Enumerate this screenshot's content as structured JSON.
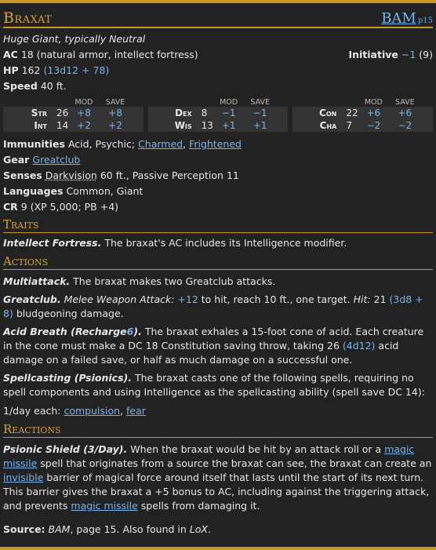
{
  "header": {
    "name": "Braxat",
    "source": "BAM",
    "page": "p15"
  },
  "meta": {
    "type_line": "Huge Giant, typically Neutral"
  },
  "ac": {
    "label": "AC",
    "value": "18 (natural armor, intellect fortress)"
  },
  "initiative": {
    "label": "Initiative",
    "mod": "−1",
    "score": "(9)"
  },
  "hp": {
    "label": "HP",
    "value": "162",
    "formula": "(13d12 + 78)"
  },
  "speed": {
    "label": "Speed",
    "value": "40 ft."
  },
  "stat_headers": {
    "mod": "MOD",
    "save": "SAVE"
  },
  "stats": [
    [
      {
        "ab": "Str",
        "score": "26",
        "mod": "+8",
        "save": "+8"
      },
      {
        "ab": "Int",
        "score": "14",
        "mod": "+2",
        "save": "+2"
      }
    ],
    [
      {
        "ab": "Dex",
        "score": "8",
        "mod": "−1",
        "save": "−1"
      },
      {
        "ab": "Wis",
        "score": "13",
        "mod": "+1",
        "save": "+1"
      }
    ],
    [
      {
        "ab": "Con",
        "score": "22",
        "mod": "+6",
        "save": "+6"
      },
      {
        "ab": "Cha",
        "score": "7",
        "mod": "−2",
        "save": "−2"
      }
    ]
  ],
  "immunities": {
    "label": "Immunities",
    "text": "Acid, Psychic;",
    "link1": "Charmed",
    "link2": "Frightened"
  },
  "gear": {
    "label": "Gear",
    "link": "Greatclub"
  },
  "senses": {
    "label": "Senses",
    "dv": "Darkvision",
    "text": "60 ft., Passive Perception 11"
  },
  "languages": {
    "label": "Languages",
    "text": "Common, Giant"
  },
  "cr": {
    "label": "CR",
    "text": "9 (XP 5,000; PB +4)"
  },
  "traits": {
    "title": "Traits",
    "intellect_name": "Intellect Fortress.",
    "intellect_text": "The braxat's AC includes its Intelligence modifier."
  },
  "actions": {
    "title": "Actions",
    "multi_name": "Multiattack.",
    "multi_text": "The braxat makes two Greatclub attacks.",
    "club_name": "Greatclub.",
    "club_type": "Melee Weapon Attack:",
    "club_bonus": "+12",
    "club_text1": "to hit, reach 10 ft., one target.",
    "club_hit": "Hit:",
    "club_dmg": "21",
    "club_formula": "(3d8 + 8)",
    "club_text2": "bludgeoning damage.",
    "acid_name": "Acid Breath (Recharge",
    "acid_recharge": "6",
    "acid_close": ").",
    "acid_text1": "The braxat exhales a 15-foot cone of acid. Each creature in the cone must make a DC 18 Constitution saving throw, taking 26",
    "acid_formula": "(4d12)",
    "acid_text2": "acid damage on a failed save, or half as much damage on a successful one.",
    "spell_name": "Spellcasting (Psionics).",
    "spell_text": "The braxat casts one of the following spells, requiring no spell components and using Intelligence as the spellcasting ability (spell save DC 14):",
    "perday": "1/day each:",
    "spell1": "compulsion",
    "spell2": "fear"
  },
  "reactions": {
    "title": "Reactions",
    "shield_name": "Psionic Shield (3/Day).",
    "shield_t1": "When the braxat would be hit by an attack roll or a",
    "mm1": "magic missile",
    "shield_t2": "spell that originates from a source the braxat can see, the braxat can create an",
    "invisible": "invisible",
    "shield_t3": "barrier of magical force around itself that lasts until the start of its next turn. This barrier gives the braxat a +5 bonus to AC, including against the triggering attack, and prevents",
    "mm2": "magic missile",
    "shield_t4": "spells from damaging it."
  },
  "footer": {
    "label": "Source:",
    "book": "BAM",
    "text": ", page 15. Also found in",
    "other": "LoX",
    "end": "."
  },
  "colors": {
    "accent": "#c9962c",
    "link": "#78b4ec",
    "background": "#222222"
  }
}
